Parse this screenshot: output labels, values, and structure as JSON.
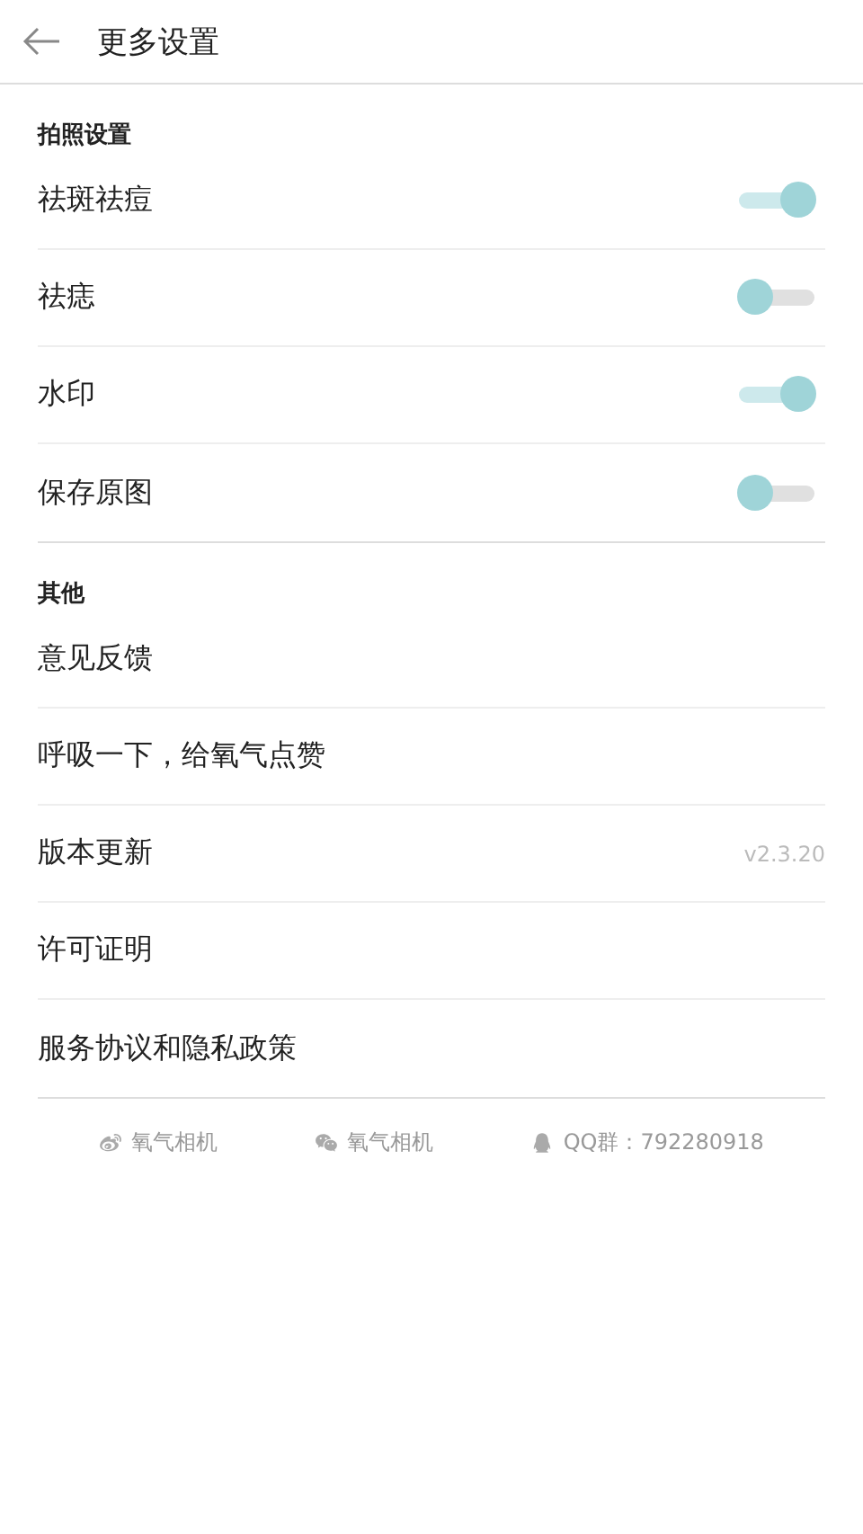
{
  "header": {
    "title": "更多设置"
  },
  "sections": [
    {
      "title": "拍照设置",
      "items": [
        {
          "kind": "toggle",
          "label": "祛斑祛痘",
          "on": true
        },
        {
          "kind": "toggle",
          "label": "祛痣",
          "on": false
        },
        {
          "kind": "toggle",
          "label": "水印",
          "on": true
        },
        {
          "kind": "toggle",
          "label": "保存原图",
          "on": false
        }
      ]
    },
    {
      "title": "其他",
      "items": [
        {
          "kind": "link",
          "label": "意见反馈"
        },
        {
          "kind": "link",
          "label": "呼吸一下，给氧气点赞"
        },
        {
          "kind": "link",
          "label": "版本更新",
          "value": "v2.3.20"
        },
        {
          "kind": "link",
          "label": "许可证明"
        },
        {
          "kind": "link",
          "label": "服务协议和隐私政策"
        }
      ]
    }
  ],
  "footer": [
    {
      "kind": "weibo",
      "text": "氧气相机"
    },
    {
      "kind": "wechat",
      "text": "氧气相机"
    },
    {
      "kind": "qq",
      "text": "QQ群：792280918"
    }
  ]
}
